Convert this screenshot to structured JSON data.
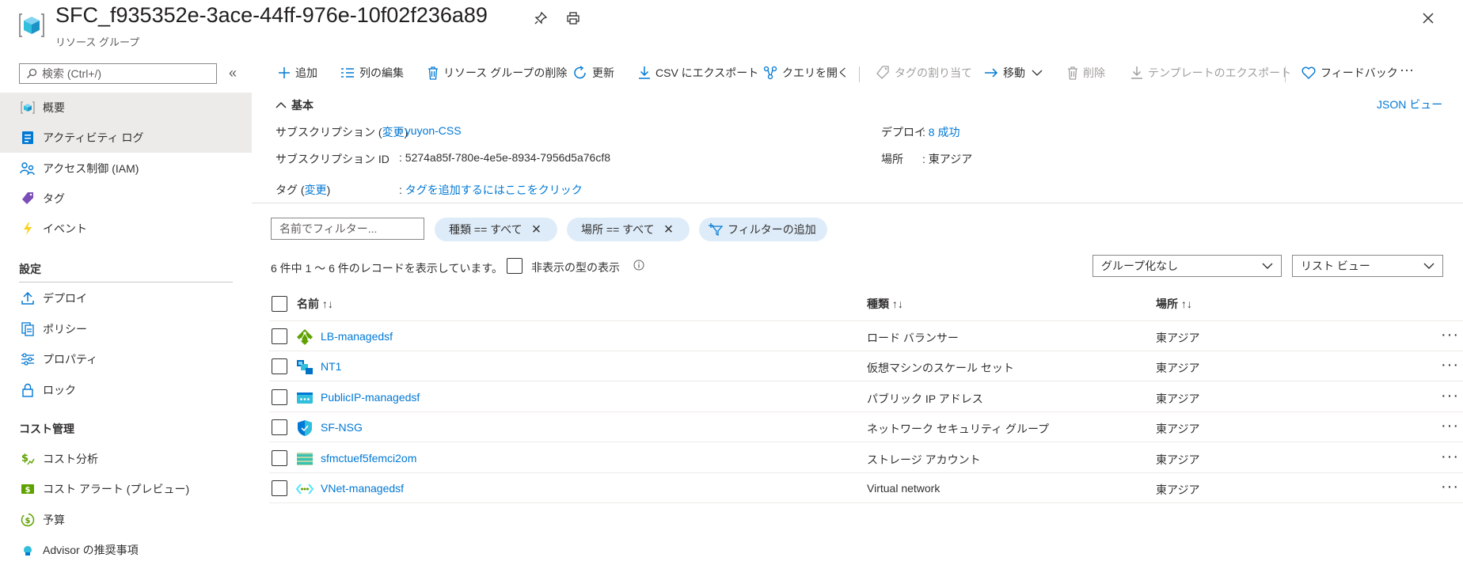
{
  "header": {
    "title": "SFC_f935352e-3ace-44ff-976e-10f02f236a89",
    "subtitle": "リソース グループ",
    "close_icon": "close-icon",
    "pin_icon": "pin-icon",
    "print_icon": "print-icon"
  },
  "sidebar": {
    "search_placeholder": "検索 (Ctrl+/)",
    "collapse_glyph": "«",
    "items": [
      {
        "label": "概要",
        "icon": "resource-group-icon",
        "selected": true
      },
      {
        "label": "アクティビティ ログ",
        "icon": "activity-log-icon"
      },
      {
        "label": "アクセス制御 (IAM)",
        "icon": "iam-icon"
      },
      {
        "label": "タグ",
        "icon": "tag-icon"
      },
      {
        "label": "イベント",
        "icon": "lightning-icon"
      }
    ],
    "section_settings": "設定",
    "settings_items": [
      {
        "label": "デプロイ",
        "icon": "upload-icon"
      },
      {
        "label": "ポリシー",
        "icon": "policy-icon"
      },
      {
        "label": "プロパティ",
        "icon": "properties-icon"
      },
      {
        "label": "ロック",
        "icon": "lock-icon"
      }
    ],
    "section_cost": "コスト管理",
    "cost_items": [
      {
        "label": "コスト分析",
        "icon": "cost-analysis-icon"
      },
      {
        "label": "コスト アラート (プレビュー)",
        "icon": "cost-alert-icon"
      },
      {
        "label": "予算",
        "icon": "budget-icon"
      },
      {
        "label": "Advisor の推奨事項",
        "icon": "advisor-icon"
      }
    ]
  },
  "toolbar": {
    "add": "追加",
    "edit_columns": "列の編集",
    "delete_rg": "リソース グループの削除",
    "refresh": "更新",
    "export_csv": "CSV にエクスポート",
    "open_query": "クエリを開く",
    "assign_tags": "タグの割り当て",
    "move": "移動",
    "delete": "削除",
    "export_template": "テンプレートのエクスポート",
    "feedback": "フィードバック",
    "more": "···"
  },
  "essentials": {
    "toggle_label": "基本",
    "json_view": "JSON ビュー",
    "subscription_label": "サブスクリプション (",
    "change": "変更",
    "close_paren": ")",
    "subscription_value": "yuyon-CSS",
    "subscription_id_label": "サブスクリプション ID",
    "subscription_id_value": "5274a85f-780e-4e5e-8934-7956d5a76cf8",
    "tags_label": "タグ (",
    "tags_value": "タグを追加するにはここをクリック",
    "deploy_label": "デプロイ",
    "deploy_value": "8 成功",
    "location_label": "場所",
    "location_value": "東アジア",
    "colon": ":"
  },
  "filters": {
    "name_placeholder": "名前でフィルター...",
    "type_pill": "種類 == すべて",
    "location_pill": "場所 == すべて",
    "add_filter": "フィルターの追加",
    "record_count": "6 件中 1 ～ 6 件のレコードを表示しています。",
    "show_hidden": "非表示の型の表示",
    "grouping": "グループ化なし",
    "view": "リスト ビュー"
  },
  "table": {
    "columns": {
      "name": "名前 ↑↓",
      "type": "種類 ↑↓",
      "location": "場所 ↑↓"
    },
    "rows": [
      {
        "name": "LB-managedsf",
        "type": "ロード バランサー",
        "location": "東アジア",
        "icon": "load-balancer-icon"
      },
      {
        "name": "NT1",
        "type": "仮想マシンのスケール セット",
        "location": "東アジア",
        "icon": "vmss-icon"
      },
      {
        "name": "PublicIP-managedsf",
        "type": "パブリック IP アドレス",
        "location": "東アジア",
        "icon": "public-ip-icon"
      },
      {
        "name": "SF-NSG",
        "type": "ネットワーク セキュリティ グループ",
        "location": "東アジア",
        "icon": "nsg-icon"
      },
      {
        "name": "sfmctuef5femci2om",
        "type": "ストレージ アカウント",
        "location": "東アジア",
        "icon": "storage-icon"
      },
      {
        "name": "VNet-managedsf",
        "type": "Virtual network",
        "location": "東アジア",
        "icon": "vnet-icon"
      }
    ],
    "row_more": "···"
  },
  "colors": {
    "accent": "#0078d4",
    "selected_bg": "#edebe9",
    "pill_bg": "#deecf9"
  }
}
